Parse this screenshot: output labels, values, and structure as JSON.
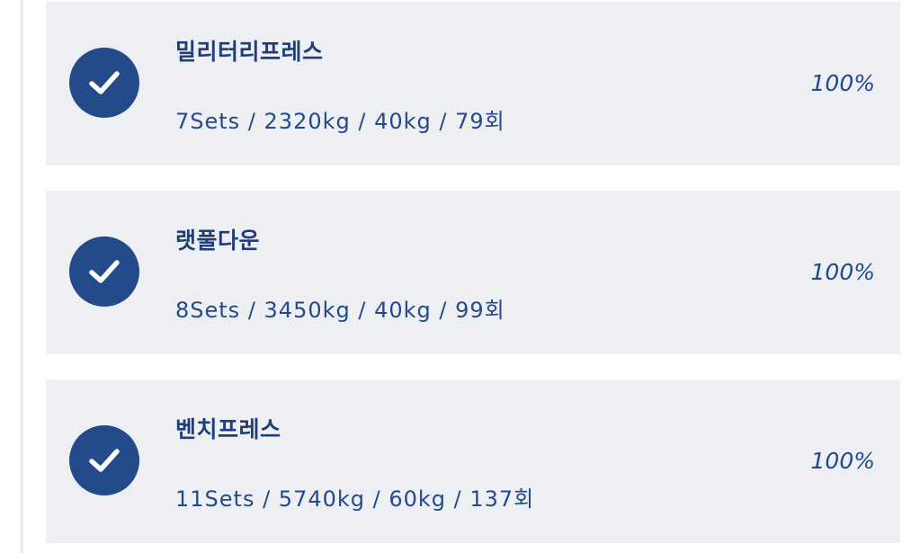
{
  "colors": {
    "card_background": "#eeeff3",
    "accent": "#234a8b",
    "check_mark": "#ffffff"
  },
  "workouts": [
    {
      "check_icon": "checkmark-icon",
      "name": "밀리터리프레스",
      "stats": "7Sets / 2320kg / 40kg / 79회",
      "completion": "100%"
    },
    {
      "check_icon": "checkmark-icon",
      "name": "랫풀다운",
      "stats": "8Sets / 3450kg / 40kg / 99회",
      "completion": "100%"
    },
    {
      "check_icon": "checkmark-icon",
      "name": "벤치프레스",
      "stats": "11Sets / 5740kg / 60kg / 137회",
      "completion": "100%"
    }
  ]
}
